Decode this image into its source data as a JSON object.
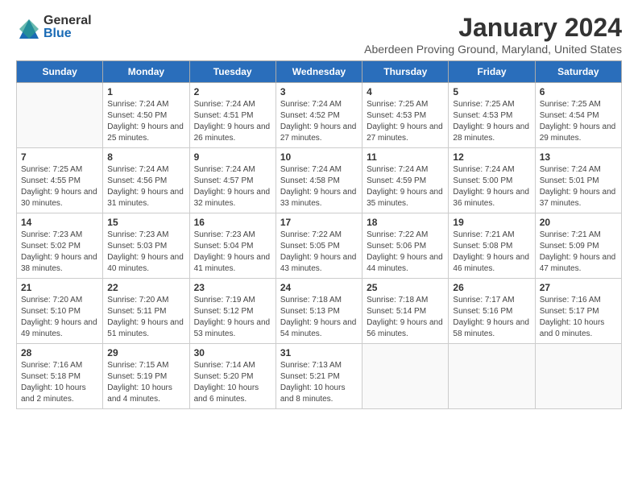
{
  "header": {
    "logo_general": "General",
    "logo_blue": "Blue",
    "month_title": "January 2024",
    "location": "Aberdeen Proving Ground, Maryland, United States"
  },
  "weekdays": [
    "Sunday",
    "Monday",
    "Tuesday",
    "Wednesday",
    "Thursday",
    "Friday",
    "Saturday"
  ],
  "weeks": [
    [
      {
        "day": "",
        "sunrise": "",
        "sunset": "",
        "daylight": ""
      },
      {
        "day": "1",
        "sunrise": "Sunrise: 7:24 AM",
        "sunset": "Sunset: 4:50 PM",
        "daylight": "Daylight: 9 hours and 25 minutes."
      },
      {
        "day": "2",
        "sunrise": "Sunrise: 7:24 AM",
        "sunset": "Sunset: 4:51 PM",
        "daylight": "Daylight: 9 hours and 26 minutes."
      },
      {
        "day": "3",
        "sunrise": "Sunrise: 7:24 AM",
        "sunset": "Sunset: 4:52 PM",
        "daylight": "Daylight: 9 hours and 27 minutes."
      },
      {
        "day": "4",
        "sunrise": "Sunrise: 7:25 AM",
        "sunset": "Sunset: 4:53 PM",
        "daylight": "Daylight: 9 hours and 27 minutes."
      },
      {
        "day": "5",
        "sunrise": "Sunrise: 7:25 AM",
        "sunset": "Sunset: 4:53 PM",
        "daylight": "Daylight: 9 hours and 28 minutes."
      },
      {
        "day": "6",
        "sunrise": "Sunrise: 7:25 AM",
        "sunset": "Sunset: 4:54 PM",
        "daylight": "Daylight: 9 hours and 29 minutes."
      }
    ],
    [
      {
        "day": "7",
        "sunrise": "Sunrise: 7:25 AM",
        "sunset": "Sunset: 4:55 PM",
        "daylight": "Daylight: 9 hours and 30 minutes."
      },
      {
        "day": "8",
        "sunrise": "Sunrise: 7:24 AM",
        "sunset": "Sunset: 4:56 PM",
        "daylight": "Daylight: 9 hours and 31 minutes."
      },
      {
        "day": "9",
        "sunrise": "Sunrise: 7:24 AM",
        "sunset": "Sunset: 4:57 PM",
        "daylight": "Daylight: 9 hours and 32 minutes."
      },
      {
        "day": "10",
        "sunrise": "Sunrise: 7:24 AM",
        "sunset": "Sunset: 4:58 PM",
        "daylight": "Daylight: 9 hours and 33 minutes."
      },
      {
        "day": "11",
        "sunrise": "Sunrise: 7:24 AM",
        "sunset": "Sunset: 4:59 PM",
        "daylight": "Daylight: 9 hours and 35 minutes."
      },
      {
        "day": "12",
        "sunrise": "Sunrise: 7:24 AM",
        "sunset": "Sunset: 5:00 PM",
        "daylight": "Daylight: 9 hours and 36 minutes."
      },
      {
        "day": "13",
        "sunrise": "Sunrise: 7:24 AM",
        "sunset": "Sunset: 5:01 PM",
        "daylight": "Daylight: 9 hours and 37 minutes."
      }
    ],
    [
      {
        "day": "14",
        "sunrise": "Sunrise: 7:23 AM",
        "sunset": "Sunset: 5:02 PM",
        "daylight": "Daylight: 9 hours and 38 minutes."
      },
      {
        "day": "15",
        "sunrise": "Sunrise: 7:23 AM",
        "sunset": "Sunset: 5:03 PM",
        "daylight": "Daylight: 9 hours and 40 minutes."
      },
      {
        "day": "16",
        "sunrise": "Sunrise: 7:23 AM",
        "sunset": "Sunset: 5:04 PM",
        "daylight": "Daylight: 9 hours and 41 minutes."
      },
      {
        "day": "17",
        "sunrise": "Sunrise: 7:22 AM",
        "sunset": "Sunset: 5:05 PM",
        "daylight": "Daylight: 9 hours and 43 minutes."
      },
      {
        "day": "18",
        "sunrise": "Sunrise: 7:22 AM",
        "sunset": "Sunset: 5:06 PM",
        "daylight": "Daylight: 9 hours and 44 minutes."
      },
      {
        "day": "19",
        "sunrise": "Sunrise: 7:21 AM",
        "sunset": "Sunset: 5:08 PM",
        "daylight": "Daylight: 9 hours and 46 minutes."
      },
      {
        "day": "20",
        "sunrise": "Sunrise: 7:21 AM",
        "sunset": "Sunset: 5:09 PM",
        "daylight": "Daylight: 9 hours and 47 minutes."
      }
    ],
    [
      {
        "day": "21",
        "sunrise": "Sunrise: 7:20 AM",
        "sunset": "Sunset: 5:10 PM",
        "daylight": "Daylight: 9 hours and 49 minutes."
      },
      {
        "day": "22",
        "sunrise": "Sunrise: 7:20 AM",
        "sunset": "Sunset: 5:11 PM",
        "daylight": "Daylight: 9 hours and 51 minutes."
      },
      {
        "day": "23",
        "sunrise": "Sunrise: 7:19 AM",
        "sunset": "Sunset: 5:12 PM",
        "daylight": "Daylight: 9 hours and 53 minutes."
      },
      {
        "day": "24",
        "sunrise": "Sunrise: 7:18 AM",
        "sunset": "Sunset: 5:13 PM",
        "daylight": "Daylight: 9 hours and 54 minutes."
      },
      {
        "day": "25",
        "sunrise": "Sunrise: 7:18 AM",
        "sunset": "Sunset: 5:14 PM",
        "daylight": "Daylight: 9 hours and 56 minutes."
      },
      {
        "day": "26",
        "sunrise": "Sunrise: 7:17 AM",
        "sunset": "Sunset: 5:16 PM",
        "daylight": "Daylight: 9 hours and 58 minutes."
      },
      {
        "day": "27",
        "sunrise": "Sunrise: 7:16 AM",
        "sunset": "Sunset: 5:17 PM",
        "daylight": "Daylight: 10 hours and 0 minutes."
      }
    ],
    [
      {
        "day": "28",
        "sunrise": "Sunrise: 7:16 AM",
        "sunset": "Sunset: 5:18 PM",
        "daylight": "Daylight: 10 hours and 2 minutes."
      },
      {
        "day": "29",
        "sunrise": "Sunrise: 7:15 AM",
        "sunset": "Sunset: 5:19 PM",
        "daylight": "Daylight: 10 hours and 4 minutes."
      },
      {
        "day": "30",
        "sunrise": "Sunrise: 7:14 AM",
        "sunset": "Sunset: 5:20 PM",
        "daylight": "Daylight: 10 hours and 6 minutes."
      },
      {
        "day": "31",
        "sunrise": "Sunrise: 7:13 AM",
        "sunset": "Sunset: 5:21 PM",
        "daylight": "Daylight: 10 hours and 8 minutes."
      },
      {
        "day": "",
        "sunrise": "",
        "sunset": "",
        "daylight": ""
      },
      {
        "day": "",
        "sunrise": "",
        "sunset": "",
        "daylight": ""
      },
      {
        "day": "",
        "sunrise": "",
        "sunset": "",
        "daylight": ""
      }
    ]
  ]
}
